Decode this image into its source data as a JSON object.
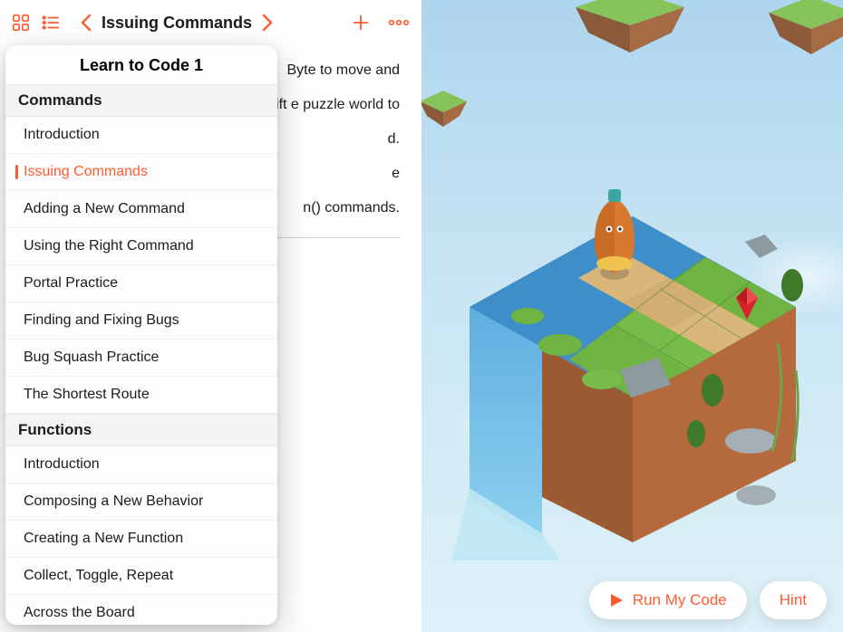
{
  "toolbar": {
    "back_title": "Issuing Commands",
    "grid_icon": "grid-icon",
    "list_icon": "list-icon",
    "plus_icon": "plus-icon",
    "more_icon": "more-icon"
  },
  "content": {
    "p1": "Byte to move and",
    "p2": "ems but can't do it ed to write Swift e puzzle world to",
    "p3": "d.",
    "p4": "e",
    "p5": "n() commands."
  },
  "popover": {
    "title": "Learn to Code 1",
    "sections": [
      {
        "header": "Commands",
        "items": [
          {
            "label": "Introduction",
            "active": false
          },
          {
            "label": "Issuing Commands",
            "active": true
          },
          {
            "label": "Adding a New Command",
            "active": false
          },
          {
            "label": "Using the Right Command",
            "active": false
          },
          {
            "label": "Portal Practice",
            "active": false
          },
          {
            "label": "Finding and Fixing Bugs",
            "active": false
          },
          {
            "label": "Bug Squash Practice",
            "active": false
          },
          {
            "label": "The Shortest Route",
            "active": false
          }
        ]
      },
      {
        "header": "Functions",
        "items": [
          {
            "label": "Introduction",
            "active": false
          },
          {
            "label": "Composing a New Behavior",
            "active": false
          },
          {
            "label": "Creating a New Function",
            "active": false
          },
          {
            "label": "Collect, Toggle, Repeat",
            "active": false
          },
          {
            "label": "Across the Board",
            "active": false
          }
        ]
      }
    ]
  },
  "buttons": {
    "run": "Run My Code",
    "hint": "Hint"
  },
  "colors": {
    "accent": "#ff5b30",
    "sky_top": "#aed5ee",
    "sky_bottom": "#dff1f8",
    "grass": "#6fb342",
    "dirt": "#c57a3f",
    "water": "#3e8fc9",
    "gem": "#d8232a"
  }
}
